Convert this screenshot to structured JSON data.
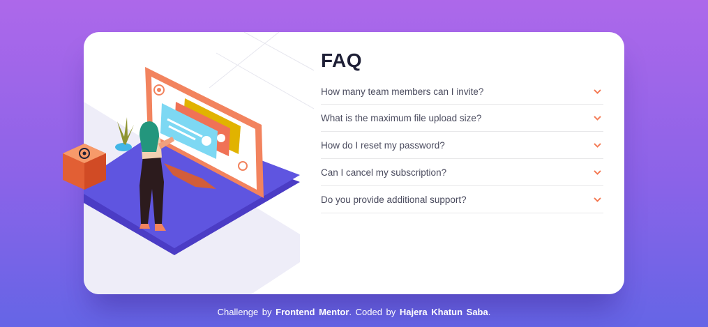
{
  "faq": {
    "title": "FAQ",
    "items": [
      {
        "question": "How many team members can I invite?",
        "icon": "chevron-down-icon"
      },
      {
        "question": "What is the maximum file upload size?",
        "icon": "chevron-down-icon"
      },
      {
        "question": "How do I reset my password?",
        "icon": "chevron-down-icon"
      },
      {
        "question": "Can I cancel my subscription?",
        "icon": "chevron-down-icon"
      },
      {
        "question": "Do you provide additional support?",
        "icon": "chevron-down-icon"
      }
    ]
  },
  "attribution": {
    "prefix": "Challenge by",
    "link1": "Frontend Mentor",
    "middle": ". Coded by",
    "link2": "Hajera Khatun Saba",
    "suffix": "."
  },
  "colors": {
    "background_top": "#ad68ea",
    "background_bottom": "#6565e6",
    "card": "#ffffff",
    "title": "#1e1f36",
    "question_text": "#4a4b5e",
    "chevron": "#f47c57",
    "divider": "#e7e7e9"
  }
}
